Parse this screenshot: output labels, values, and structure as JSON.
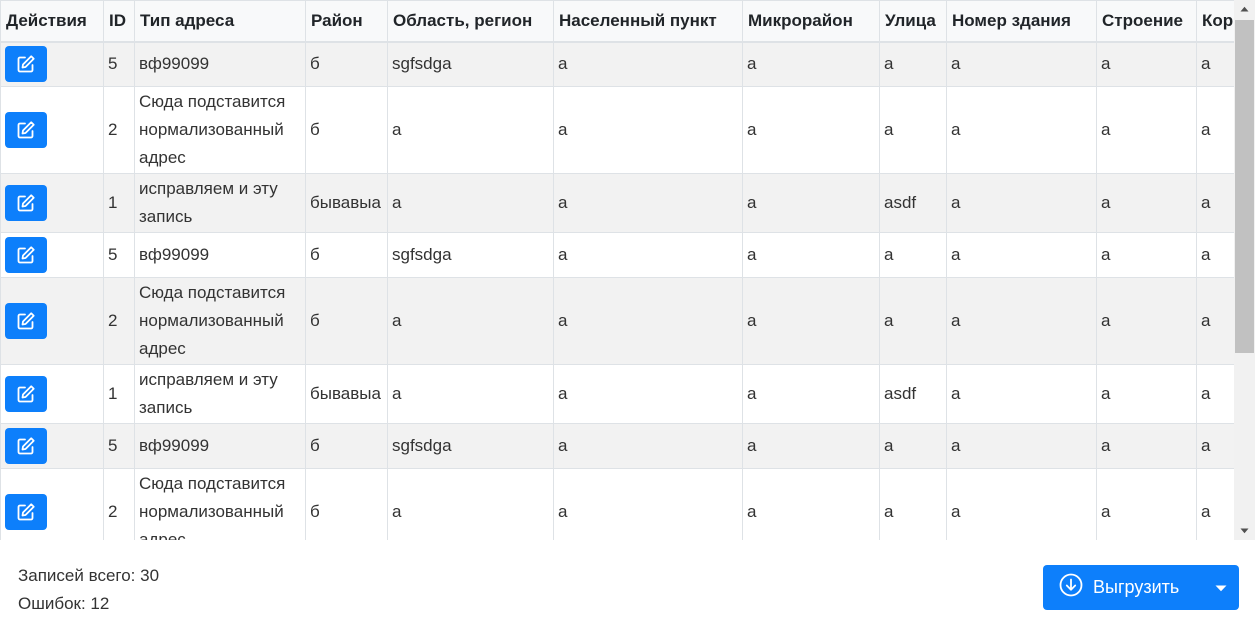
{
  "table": {
    "columns": [
      "Действия",
      "ID",
      "Тип адреса",
      "Район",
      "Область, регион",
      "Населенный пункт",
      "Микрорайон",
      "Улица",
      "Номер здания",
      "Строение",
      "Кор"
    ],
    "rows": [
      {
        "id": "5",
        "type": "вф99099",
        "district": "б",
        "region": "sgfsdga",
        "locality": "a",
        "microdistrict": "a",
        "street": "a",
        "building_no": "a",
        "structure": "a",
        "korpus": "a"
      },
      {
        "id": "2",
        "type": "Сюда подставится нормализованный адрес",
        "district": "б",
        "region": "a",
        "locality": "a",
        "microdistrict": "a",
        "street": "a",
        "building_no": "a",
        "structure": "a",
        "korpus": "a"
      },
      {
        "id": "1",
        "type": "исправляем и эту запись",
        "district": "бывавыа",
        "region": "a",
        "locality": "a",
        "microdistrict": "a",
        "street": "asdf",
        "building_no": "a",
        "structure": "a",
        "korpus": "a"
      },
      {
        "id": "5",
        "type": "вф99099",
        "district": "б",
        "region": "sgfsdga",
        "locality": "a",
        "microdistrict": "a",
        "street": "a",
        "building_no": "a",
        "structure": "a",
        "korpus": "a"
      },
      {
        "id": "2",
        "type": "Сюда подставится нормализованный адрес",
        "district": "б",
        "region": "a",
        "locality": "a",
        "microdistrict": "a",
        "street": "a",
        "building_no": "a",
        "structure": "a",
        "korpus": "a"
      },
      {
        "id": "1",
        "type": "исправляем и эту запись",
        "district": "бывавыа",
        "region": "a",
        "locality": "a",
        "microdistrict": "a",
        "street": "asdf",
        "building_no": "a",
        "structure": "a",
        "korpus": "a"
      },
      {
        "id": "5",
        "type": "вф99099",
        "district": "б",
        "region": "sgfsdga",
        "locality": "a",
        "microdistrict": "a",
        "street": "a",
        "building_no": "a",
        "structure": "a",
        "korpus": "a"
      },
      {
        "id": "2",
        "type": "Сюда подставится нормализованный адрес",
        "district": "б",
        "region": "a",
        "locality": "a",
        "microdistrict": "a",
        "street": "a",
        "building_no": "a",
        "structure": "a",
        "korpus": "a"
      }
    ],
    "action_icon": "edit-icon"
  },
  "footer": {
    "total_label": "Записей всего: 30",
    "errors_label": "Ошибок: 12",
    "export_label": "Выгрузить",
    "export_icon": "download-circle-icon",
    "caret_icon": "caret-down-icon"
  },
  "colors": {
    "accent": "#0d7ffb",
    "row_stripe": "#f2f2f2",
    "border": "#dee2e6",
    "text": "#333333"
  }
}
